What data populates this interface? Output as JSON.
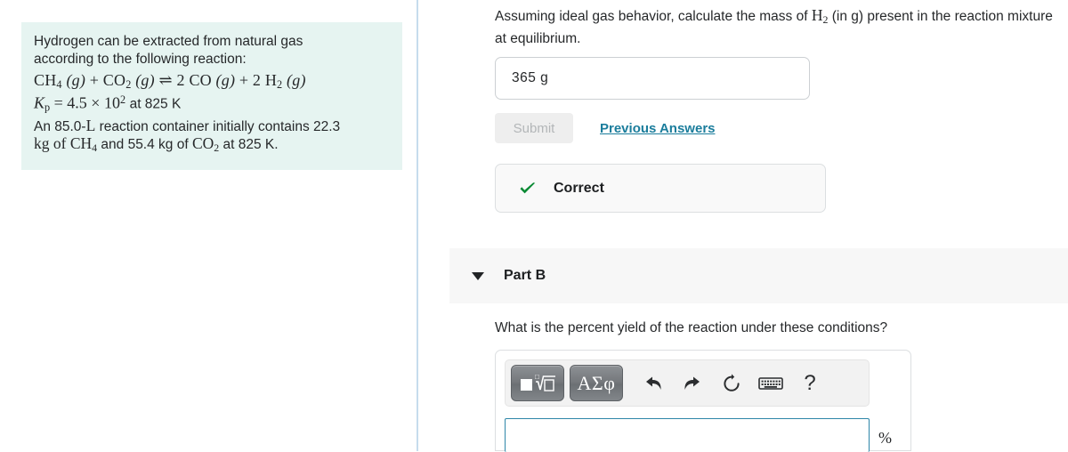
{
  "problem": {
    "intro_line_1": "Hydrogen can be extracted from natural gas",
    "intro_line_2": "according to the following reaction:",
    "equation": "CH4 (g) + CO2 (g) ⇌ 2 CO (g) + 2 H2 (g)",
    "equilibrium_constant": "Kp = 4.5 × 10² at 825 K",
    "conditions_line_1": "An 85.0-L reaction container initially contains 22.3",
    "conditions_line_2": "kg of CH4 and 55.4 kg of CO2 at 825 K.",
    "reagent_1": "CH",
    "reagent_1_sub": "4",
    "reagent_2": "CO",
    "reagent_2_sub": "2",
    "product_1": "CO",
    "product_2": "H",
    "product_2_sub": "2",
    "stoich_co": "2",
    "stoich_h2": "2",
    "arrow": "⇌",
    "plus": "+",
    "gas_state": "(g)",
    "kp_symbol": "K",
    "kp_sub": "p",
    "kp_equals": "= 4.5",
    "kp_times": "×",
    "kp_base": "10",
    "kp_exp": "2",
    "kp_temp": "at 825 K",
    "volume_text": "An 85.0-",
    "volume_unit": "L",
    "volume_tail": " reaction container initially contains 22.3",
    "mass_prefix": "kg of ",
    "mass_ch4": "CH",
    "mass_ch4_sub": "4",
    "mass_mid": " and 55.4 kg of ",
    "mass_co2": "CO",
    "mass_co2_sub": "2",
    "mass_tail": " at 825 K."
  },
  "part_a": {
    "question_prefix": "Assuming ideal gas behavior, calculate the mass of ",
    "question_math": "H",
    "question_math_sub": "2",
    "question_suffix": " (in g) present in the reaction mixture at equilibrium.",
    "answer_value": "365  g",
    "submit_label": "Submit",
    "previous_answers_label": "Previous Answers",
    "feedback_label": "Correct",
    "feedback_icon": "check-icon",
    "feedback_color": "#0a8a34"
  },
  "part_b": {
    "title": "Part B",
    "toggle_icon": "chevron-down-icon",
    "question": "What is the percent yield of the reaction under these conditions?",
    "answer_value": "",
    "unit_label": "%",
    "toolbar": {
      "template_button_label": "math-template",
      "greek_button_label": "ΑΣφ",
      "undo_icon": "undo-arrow-icon",
      "redo_icon": "redo-arrow-icon",
      "reset_icon": "reset-circle-icon",
      "keyboard_icon": "keyboard-icon",
      "help_label": "?"
    }
  },
  "colors": {
    "problem_panel_bg": "#e6f4f1",
    "divider": "#c6dced",
    "link": "#1b7d9c",
    "correct_green": "#0a8a34",
    "input_focus_border": "#2e86a8",
    "band_bg": "#f7f7f7"
  }
}
